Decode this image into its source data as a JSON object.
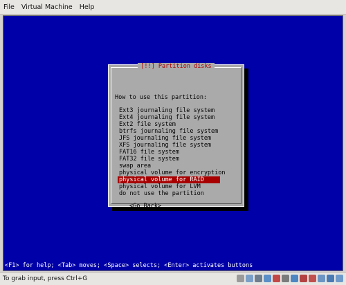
{
  "menubar": {
    "items": [
      "File",
      "Virtual Machine",
      "Help"
    ]
  },
  "dialog": {
    "title": "[!!] Partition disks",
    "prompt": "How to use this partition:",
    "options": [
      "Ext3 journaling file system",
      "Ext4 journaling file system",
      "Ext2 file system",
      "btrfs journaling file system",
      "JFS journaling file system",
      "XFS journaling file system",
      "FAT16 file system",
      "FAT32 file system",
      "swap area",
      "physical volume for encryption",
      "physical volume for RAID",
      "physical volume for LVM",
      "do not use the partition"
    ],
    "selected_index": 10,
    "back_button": "<Go Back>"
  },
  "help_line": "<F1> for help; <Tab> moves; <Space> selects; <Enter> activates buttons",
  "status_bar": {
    "text": "To grab input, press Ctrl+G"
  },
  "tray_icons": [
    "harddisk-icon",
    "cdrom-icon",
    "floppy-icon",
    "network-icon",
    "usb-icon",
    "sound-icon",
    "display-icon",
    "printer-icon",
    "serial-icon",
    "shared-folder-icon",
    "capture-icon",
    "lock-icon"
  ],
  "colors": {
    "screen_bg": "#0000a8",
    "dialog_bg": "#aaaaaa",
    "highlight": "#a80000",
    "title": "#a80000"
  }
}
